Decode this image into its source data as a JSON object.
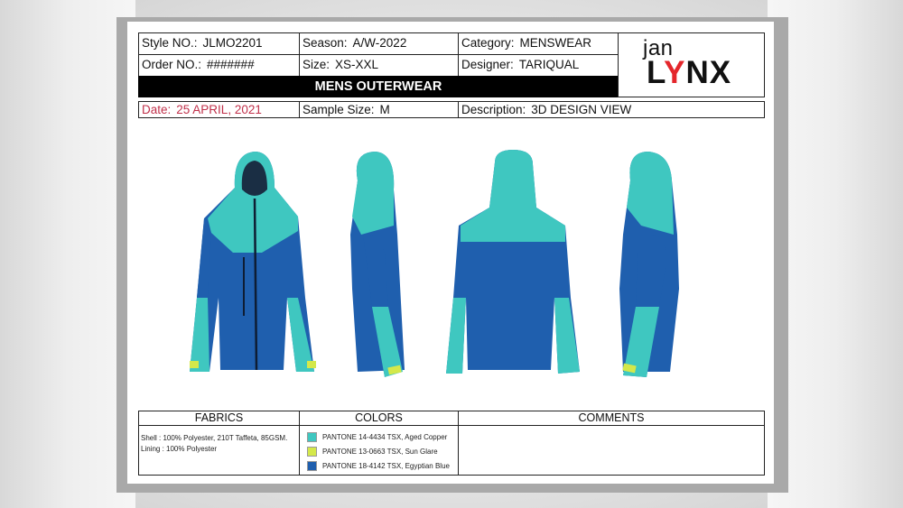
{
  "header": {
    "style_label": "Style NO.:",
    "style_value": "JLMO2201",
    "season_label": "Season:",
    "season_value": "A/W-2022",
    "category_label": "Category:",
    "category_value": "MENSWEAR",
    "order_label": "Order NO.:",
    "order_value": "#######",
    "size_label": "Size:",
    "size_value": "XS-XXL",
    "designer_label": "Designer:",
    "designer_value": "TARIQUAL",
    "title": "MENS OUTERWEAR",
    "date_label": "Date:",
    "date_value": "25 APRIL, 2021",
    "sample_label": "Sample Size:",
    "sample_value": "M",
    "description_label": "Description:",
    "description_value": "3D DESIGN VIEW"
  },
  "logo": {
    "small": "jan",
    "big_prefix": "L",
    "big_y": "Y",
    "big_suffix": "NX"
  },
  "views": [
    "front",
    "side-left",
    "back",
    "side-right"
  ],
  "colors_palette": {
    "aqua": "#3fc7c0",
    "blue": "#1f5fae",
    "lime": "#d4e84a",
    "date_text": "#c0304a"
  },
  "table": {
    "fabrics_header": "FABRICS",
    "colors_header": "COLORS",
    "comments_header": "COMMENTS",
    "fabrics_lines": [
      "Shell : 100% Polyester, 210T Taffeta, 85GSM.",
      "Lining : 100% Polyester"
    ],
    "colors": [
      {
        "swatch": "#3fc7c0",
        "label": "PANTONE 14-4434 TSX, Aged Copper"
      },
      {
        "swatch": "#d4e84a",
        "label": "PANTONE 13-0663 TSX, Sun Glare"
      },
      {
        "swatch": "#1f5fae",
        "label": "PANTONE 18-4142 TSX, Egyptian Blue"
      }
    ],
    "comments": ""
  }
}
